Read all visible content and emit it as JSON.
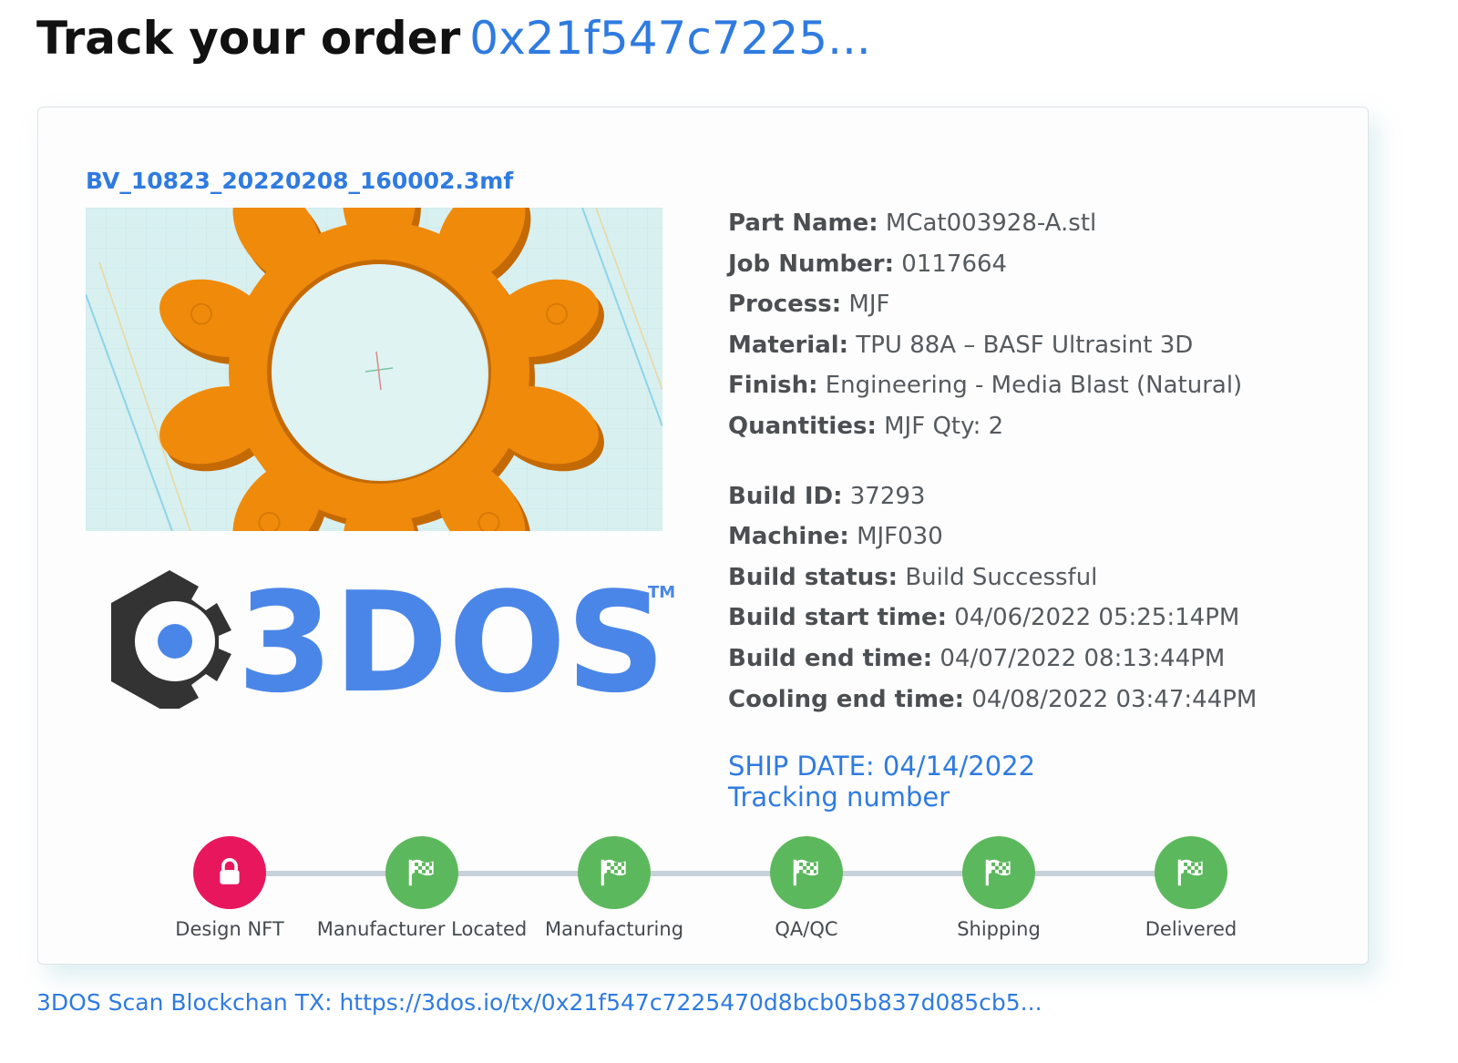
{
  "header": {
    "title": "Track your order",
    "order_id": "0x21f547c7225..."
  },
  "card": {
    "file_name": "BV_10823_20220208_160002.3mf",
    "preview_icon": "orange-gear-model-icon",
    "logo": {
      "text": "3DOS",
      "trademark": "TM",
      "mark_color": "#333333",
      "brand_color": "#4a86e8"
    },
    "details": [
      {
        "label": "Part Name:",
        "value": "MCat003928-A.stl"
      },
      {
        "label": "Job Number:",
        "value": "0117664"
      },
      {
        "label": "Process:",
        "value": "MJF"
      },
      {
        "label": "Material:",
        "value": "TPU 88A – BASF Ultrasint 3D"
      },
      {
        "label": "Finish:",
        "value": "Engineering - Media Blast (Natural)"
      },
      {
        "label": "Quantities:",
        "value": "MJF Qty: 2"
      }
    ],
    "build": [
      {
        "label": "Build ID:",
        "value": "37293"
      },
      {
        "label": "Machine:",
        "value": "MJF030"
      },
      {
        "label": "Build status:",
        "value": "Build Successful"
      },
      {
        "label": "Build start time:",
        "value": "04/06/2022 05:25:14PM"
      },
      {
        "label": "Build end time:",
        "value": "04/07/2022 08:13:44PM"
      },
      {
        "label": "Cooling end time:",
        "value": "04/08/2022 03:47:44PM"
      }
    ],
    "ship_date": "SHIP DATE: 04/14/2022",
    "tracking_link": "Tracking number",
    "steps": [
      {
        "label": "Design NFT",
        "icon": "lock-icon",
        "color": "#e8175d"
      },
      {
        "label": "Manufacturer Located",
        "icon": "checkered-flag-icon",
        "color": "#5cb85c"
      },
      {
        "label": "Manufacturing",
        "icon": "checkered-flag-icon",
        "color": "#5cb85c"
      },
      {
        "label": "QA/QC",
        "icon": "checkered-flag-icon",
        "color": "#5cb85c"
      },
      {
        "label": "Shipping",
        "icon": "checkered-flag-icon",
        "color": "#5cb85c"
      },
      {
        "label": "Delivered",
        "icon": "checkered-flag-icon",
        "color": "#5cb85c"
      }
    ]
  },
  "footer": {
    "blockchain_link": "3DOS Scan Blockchan TX: https://3dos.io/tx/0x21f547c7225470d8bcb05b837d085cb5..."
  },
  "colors": {
    "link": "#2f7be0",
    "gear": "#f08a0a",
    "preview_bg": "#d8f0f0"
  }
}
